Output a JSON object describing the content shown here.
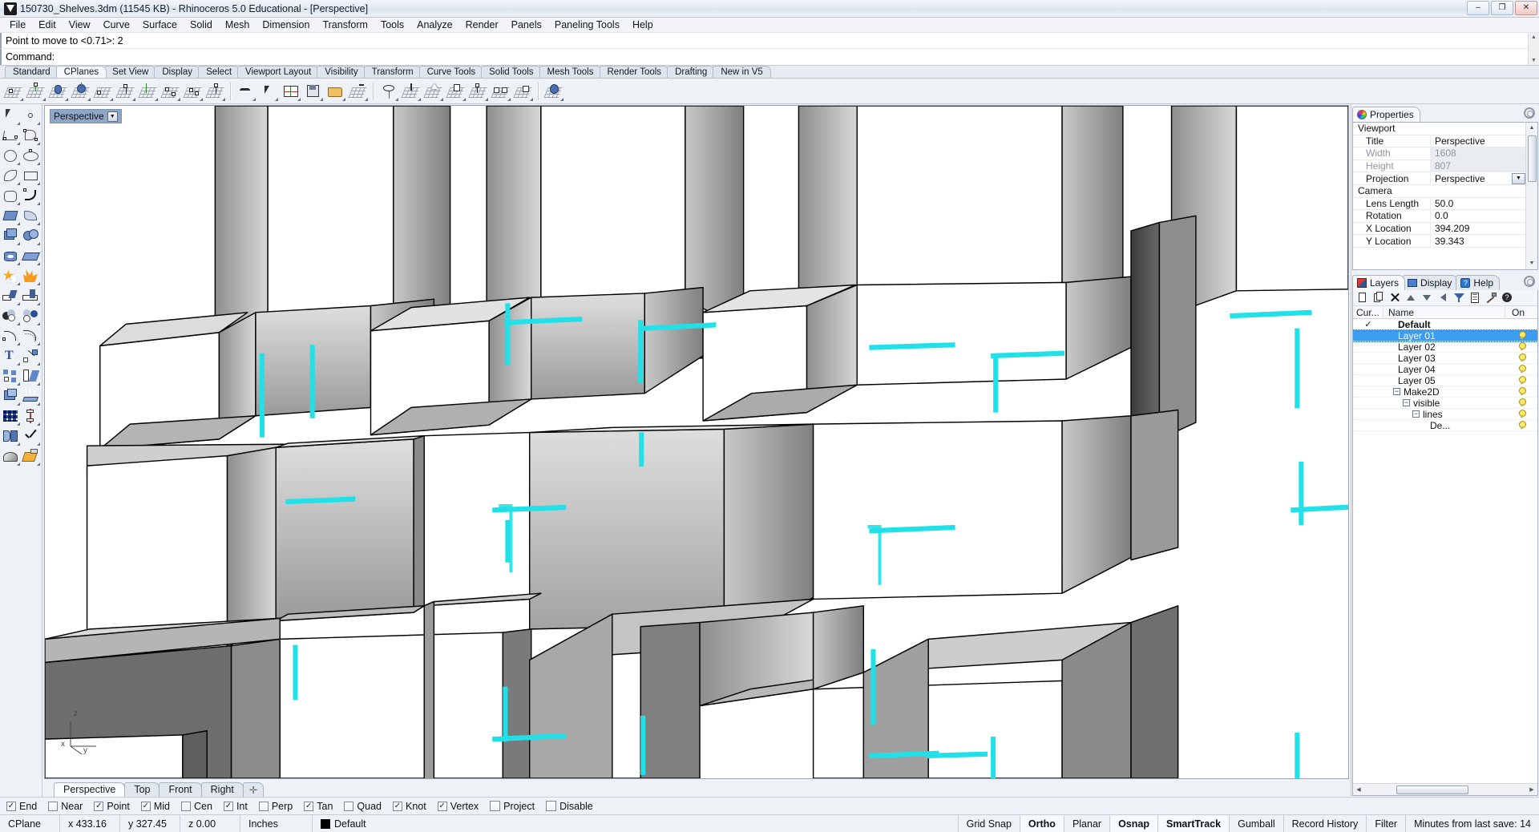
{
  "window": {
    "title": "150730_Shelves.3dm (11545 KB) - Rhinoceros 5.0 Educational - [Perspective]",
    "minimize": "–",
    "maximize": "❐",
    "close": "✕"
  },
  "menu": {
    "items": [
      "File",
      "Edit",
      "View",
      "Curve",
      "Surface",
      "Solid",
      "Mesh",
      "Dimension",
      "Transform",
      "Tools",
      "Analyze",
      "Render",
      "Panels",
      "Paneling Tools",
      "Help"
    ]
  },
  "command": {
    "history": "Point to move to <0.71>: 2",
    "label": "Command:",
    "value": "",
    "placeholder": ""
  },
  "toolbar_tabs": {
    "items": [
      "Standard",
      "CPlanes",
      "Set View",
      "Display",
      "Select",
      "Viewport Layout",
      "Visibility",
      "Transform",
      "Curve Tools",
      "Solid Tools",
      "Mesh Tools",
      "Render Tools",
      "Drafting",
      "New in V5"
    ],
    "active": "CPlanes"
  },
  "viewport": {
    "title": "Perspective",
    "caret": "▼",
    "axis": {
      "z": "z",
      "x": "x",
      "y": "y"
    },
    "tabs": [
      {
        "label": "Perspective",
        "active": true
      },
      {
        "label": "Top",
        "active": false
      },
      {
        "label": "Front",
        "active": false
      },
      {
        "label": "Right",
        "active": false
      }
    ],
    "add_tab": "✛"
  },
  "properties_panel": {
    "tab_label": "Properties",
    "tab_icon": "color-wheel-icon",
    "gear_icon": "gear-icon",
    "rows": [
      {
        "type": "group",
        "name": "Viewport"
      },
      {
        "type": "row",
        "name": "Title",
        "value": "Perspective",
        "dim": false
      },
      {
        "type": "row",
        "name": "Width",
        "value": "1608",
        "dim": true
      },
      {
        "type": "row",
        "name": "Height",
        "value": "807",
        "dim": true
      },
      {
        "type": "dropdown",
        "name": "Projection",
        "value": "Perspective",
        "dim": false
      },
      {
        "type": "group",
        "name": "Camera"
      },
      {
        "type": "row",
        "name": "Lens Length",
        "value": "50.0",
        "dim": false
      },
      {
        "type": "row",
        "name": "Rotation",
        "value": "0.0",
        "dim": false
      },
      {
        "type": "row",
        "name": "X Location",
        "value": "394.209",
        "dim": false
      },
      {
        "type": "row",
        "name": "Y Location",
        "value": "39.343",
        "dim": false
      }
    ]
  },
  "layers_panel": {
    "tabs": [
      {
        "label": "Layers",
        "active": true,
        "icon": "layers-icon"
      },
      {
        "label": "Display",
        "active": false,
        "icon": "monitor-icon"
      },
      {
        "label": "Help",
        "active": false,
        "icon": "help-icon"
      }
    ],
    "gear_icon": "gear-icon",
    "tools": [
      "new-layer-icon",
      "copy-layer-icon",
      "delete-layer-icon",
      "move-up-icon",
      "move-down-icon",
      "move-left-icon",
      "filter-icon",
      "properties-icon",
      "tools-icon",
      "help-icon"
    ],
    "columns": {
      "current": "Cur...",
      "name": "Name",
      "on": "On"
    },
    "rows": [
      {
        "name": "Default",
        "current": true,
        "on": false,
        "indent": 0,
        "bold": true,
        "selected": false,
        "expander": null
      },
      {
        "name": "Layer 01",
        "current": false,
        "on": true,
        "indent": 0,
        "bold": false,
        "selected": true,
        "expander": null
      },
      {
        "name": "Layer 02",
        "current": false,
        "on": true,
        "indent": 0,
        "bold": false,
        "selected": false,
        "expander": null
      },
      {
        "name": "Layer 03",
        "current": false,
        "on": true,
        "indent": 0,
        "bold": false,
        "selected": false,
        "expander": null
      },
      {
        "name": "Layer 04",
        "current": false,
        "on": true,
        "indent": 0,
        "bold": false,
        "selected": false,
        "expander": null
      },
      {
        "name": "Layer 05",
        "current": false,
        "on": true,
        "indent": 0,
        "bold": false,
        "selected": false,
        "expander": null
      },
      {
        "name": "Make2D",
        "current": false,
        "on": true,
        "indent": 0,
        "bold": false,
        "selected": false,
        "expander": "−"
      },
      {
        "name": "visible",
        "current": false,
        "on": true,
        "indent": 1,
        "bold": false,
        "selected": false,
        "expander": "−"
      },
      {
        "name": "lines",
        "current": false,
        "on": true,
        "indent": 2,
        "bold": false,
        "selected": false,
        "expander": "−"
      },
      {
        "name": "De...",
        "current": false,
        "on": true,
        "indent": 3,
        "bold": false,
        "selected": false,
        "expander": null
      }
    ]
  },
  "osnap": {
    "items": [
      {
        "label": "End",
        "checked": true
      },
      {
        "label": "Near",
        "checked": false
      },
      {
        "label": "Point",
        "checked": true
      },
      {
        "label": "Mid",
        "checked": true
      },
      {
        "label": "Cen",
        "checked": false
      },
      {
        "label": "Int",
        "checked": true
      },
      {
        "label": "Perp",
        "checked": false
      },
      {
        "label": "Tan",
        "checked": true
      },
      {
        "label": "Quad",
        "checked": false
      },
      {
        "label": "Knot",
        "checked": true
      },
      {
        "label": "Vertex",
        "checked": true
      },
      {
        "label": "Project",
        "checked": false
      },
      {
        "label": "Disable",
        "checked": false
      }
    ],
    "check_glyph": "✓"
  },
  "statusbar": {
    "cplane": "CPlane",
    "x": "x 433.16",
    "y": "y 327.45",
    "z": "z 0.00",
    "units": "Inches",
    "layer": "Default",
    "layer_color": "#000000",
    "toggles": [
      {
        "label": "Grid Snap",
        "on": false
      },
      {
        "label": "Ortho",
        "on": true
      },
      {
        "label": "Planar",
        "on": false
      },
      {
        "label": "Osnap",
        "on": true
      },
      {
        "label": "SmartTrack",
        "on": true
      },
      {
        "label": "Gumball",
        "on": false
      },
      {
        "label": "Record History",
        "on": false
      },
      {
        "label": "Filter",
        "on": false
      }
    ],
    "save_info": "Minutes from last save: 14"
  },
  "scene": {
    "description": "3D shelving grid model in shaded perspective view",
    "accent_color": "#22e0e8",
    "background": "#ffffff"
  }
}
